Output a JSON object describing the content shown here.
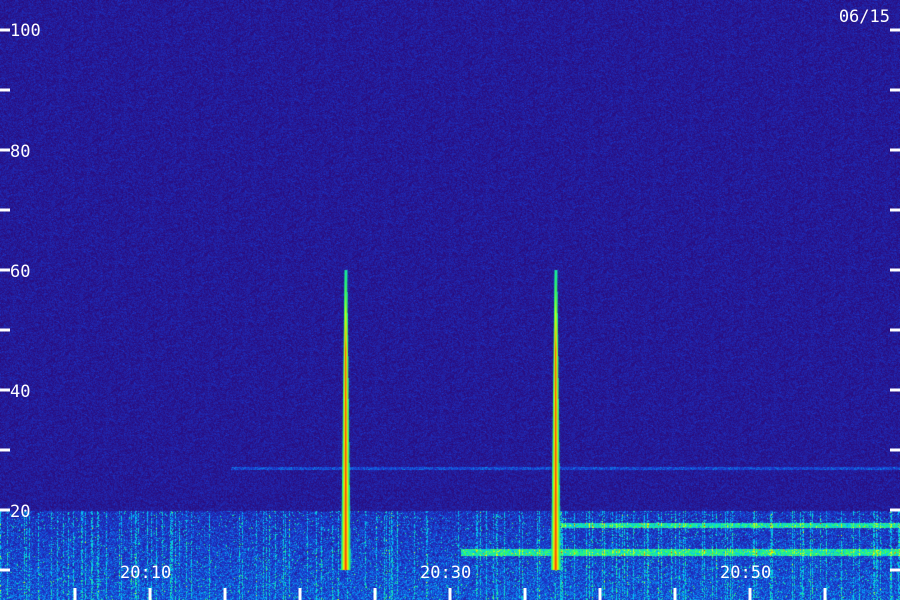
{
  "chart_data": {
    "type": "heatmap",
    "title": "",
    "date_label": "06/15",
    "xlabel": "",
    "ylabel": "",
    "x_tick_labels": [
      "20:10",
      "20:30",
      "20:50"
    ],
    "x_minor_tick_labels": [],
    "y_tick_labels": [
      "100",
      "80",
      "60",
      "40",
      "20"
    ],
    "xlim": [
      "20:00",
      "21:00"
    ],
    "ylim": [
      0,
      105
    ],
    "y_ticks": [
      10,
      20,
      30,
      40,
      50,
      60,
      70,
      80,
      90,
      100
    ],
    "x_ticks_minutes": [
      5,
      10,
      15,
      20,
      25,
      30,
      35,
      40,
      45,
      50,
      55
    ],
    "colormap": [
      "#2a0a7a",
      "#1a3ad0",
      "#00c8ff",
      "#30ff60",
      "#ffff00",
      "#ff2000"
    ],
    "background_color": "#2a0a7a",
    "label_color": "#ffffff",
    "events": [
      {
        "time": "20:23",
        "peak_value": 60
      },
      {
        "time": "20:37",
        "peak_value": 60
      }
    ],
    "bands": [
      {
        "value_range": [
          0,
          20
        ],
        "note": "broadband low-level noise"
      },
      {
        "value_range": [
          27,
          27
        ],
        "note": "narrow horizontal line"
      }
    ]
  }
}
